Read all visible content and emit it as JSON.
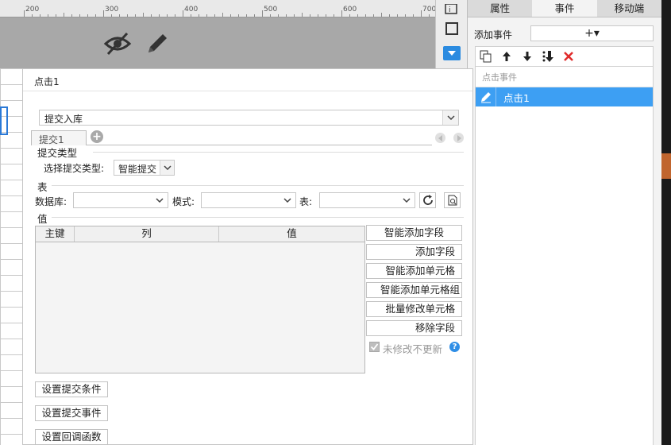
{
  "ruler": {
    "ticks": [
      "200",
      "300",
      "400",
      "500",
      "600",
      "700"
    ]
  },
  "right_panel": {
    "tabs": [
      {
        "label": "属性",
        "active": false
      },
      {
        "label": "事件",
        "active": true
      },
      {
        "label": "移动端",
        "active": false
      }
    ],
    "add_event_label": "添加事件",
    "add_button_symbol": "+▾",
    "event_group": "点击事件",
    "event_item": "点击1"
  },
  "dialog": {
    "title": "点击1",
    "action_value": "提交入库",
    "subtab": "提交1",
    "section_submit_type": "提交类型",
    "submit_type_label": "选择提交类型:",
    "submit_type_value": "智能提交",
    "section_table": "表",
    "database_label": "数据库:",
    "schema_label": "模式:",
    "table_label": "表:",
    "section_values": "值",
    "columns": [
      "主键",
      "列",
      "值"
    ],
    "side_buttons": [
      "智能添加字段",
      "添加字段",
      "智能添加单元格",
      "智能添加单元格组",
      "批量修改单元格",
      "移除字段"
    ],
    "checkbox_label": "未修改不更新",
    "help_symbol": "?",
    "bottom_buttons": [
      "设置提交条件",
      "设置提交事件",
      "设置回调函数"
    ]
  },
  "colors": {
    "selection_blue": "#3d9ff3",
    "delete_red": "#e02a2a",
    "help_blue": "#2f8ee6"
  }
}
